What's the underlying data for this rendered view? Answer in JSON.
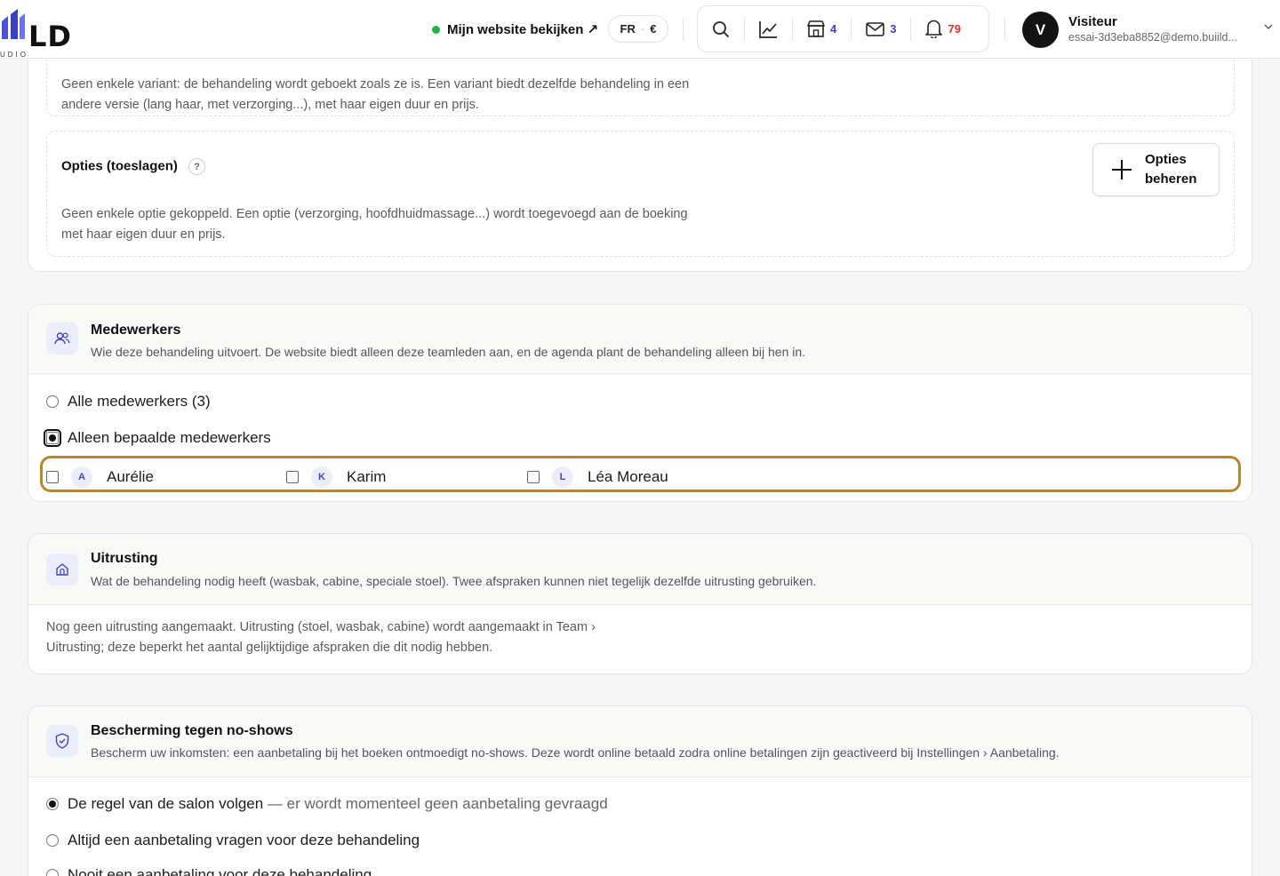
{
  "header": {
    "logo_text": "LD",
    "logo_sub": "UDIO",
    "site_link_label": "Mijn website bekijken ↗",
    "lang": "FR",
    "currency": "€",
    "counts": {
      "store": "4",
      "mail": "3",
      "notifications": "79"
    },
    "user": {
      "initial": "V",
      "name": "Visiteur",
      "email": "essai-3d3eba8852@demo.buiild..."
    }
  },
  "variants": {
    "description": "Geen enkele variant: de behandeling wordt geboekt zoals ze is. Een variant biedt dezelfde behandeling in een andere versie (lang haar, met verzorging...), met haar eigen duur en prijs."
  },
  "options": {
    "title": "Opties (toeslagen)",
    "help": "?",
    "button_label": "Opties beheren",
    "description": "Geen enkele optie gekoppeld. Een optie (verzorging, hoofdhuidmassage...) wordt toegevoegd aan de boeking met haar eigen duur en prijs."
  },
  "staff": {
    "title": "Medewerkers",
    "description": "Wie deze behandeling uitvoert. De website biedt alleen deze teamleden aan, en de agenda plant de behandeling alleen bij hen in.",
    "radio_all": "Alle medewerkers (3)",
    "radio_specific": "Alleen bepaalde medewerkers",
    "members": [
      {
        "initial": "A",
        "name": "Aurélie",
        "checked": false
      },
      {
        "initial": "K",
        "name": "Karim",
        "checked": false
      },
      {
        "initial": "L",
        "name": "Léa Moreau",
        "checked": false
      }
    ]
  },
  "equipment": {
    "title": "Uitrusting",
    "description": "Wat de behandeling nodig heeft (wasbak, cabine, speciale stoel). Twee afspraken kunnen niet tegelijk dezelfde uitrusting gebruiken.",
    "empty_text": "Nog geen uitrusting aangemaakt. Uitrusting (stoel, wasbak, cabine) wordt aangemaakt in Team › Uitrusting; deze beperkt het aantal gelijktijdige afspraken die dit nodig hebben."
  },
  "noshow": {
    "title": "Bescherming tegen no-shows",
    "description": "Bescherm uw inkomsten: een aanbetaling bij het boeken ontmoedigt no-shows. Deze wordt online betaald zodra online betalingen zijn geactiveerd bij Instellingen › Aanbetaling.",
    "option_follow": "De regel van de salon volgen",
    "option_follow_note": " — er wordt momenteel geen aanbetaling gevraagd",
    "option_always": "Altijd een aanbetaling vragen voor deze behandeling",
    "option_never": "Nooit een aanbetaling voor deze behandeling"
  },
  "colors": {
    "accent": "#3b3fc4",
    "focus_ring": "#b8872a",
    "status_online": "#22b24c",
    "alert": "#d8332b"
  },
  "icons": [
    "search-icon",
    "chart-icon",
    "store-icon",
    "mail-icon",
    "bell-icon",
    "chevron-down-icon",
    "users-icon",
    "home-icon",
    "shield-icon",
    "plus-icon"
  ]
}
